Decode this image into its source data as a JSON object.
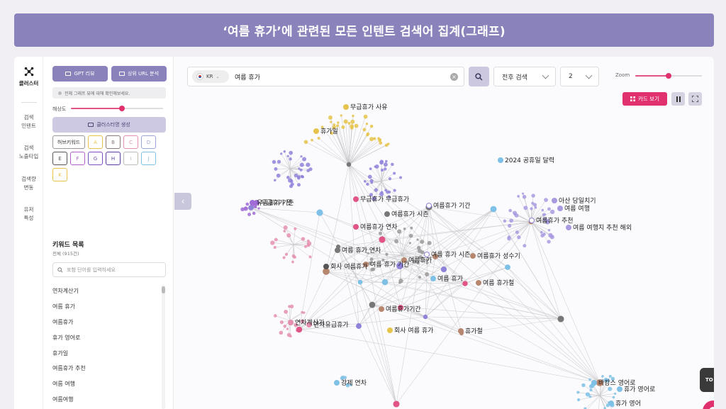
{
  "banner": {
    "title": "‘여름 휴가’에 관련된 모든 인텐트 검색어 집계(그래프)"
  },
  "nav": {
    "cluster_label": "클러스터",
    "items": [
      {
        "label": "검색\n인텐트"
      },
      {
        "label": "검색\n노출타입"
      },
      {
        "label": "검색량\n변동"
      },
      {
        "label": "유저\n특성"
      }
    ]
  },
  "panel": {
    "gpt_review": "GPT 리뷰",
    "top_url": "상위 URL 분석",
    "hint": "전체 그래프 뷰에 대해 확인해보세요.",
    "resolution_label": "해상도",
    "resolution_value": 0.55,
    "generate_cluster": "클러스터명 생성",
    "chips": [
      "허브키워드",
      "A",
      "B",
      "C",
      "D",
      "E",
      "F",
      "G",
      "H",
      "I",
      "J",
      "K"
    ],
    "chip_colors": {
      "허브키워드": "#555555",
      "A": "#e6c34a",
      "B": "#8a7a7a",
      "C": "#e58fb0",
      "D": "#9aa7d6",
      "E": "#555555",
      "F": "#b061c9",
      "G": "#7a4fc0",
      "H": "#5b3aa0",
      "I": "#bbbbbb",
      "J": "#7fc1e6",
      "K": "#e6c34a"
    },
    "keyword_title": "키워드 목록",
    "keyword_count": "전체 (915건)",
    "keyword_search_placeholder": "포함 단어를 입력하세요",
    "keywords": [
      "연차계산기",
      "여름 휴가",
      "여름휴가",
      "휴가 영어로",
      "휴가일",
      "여름휴가 추천",
      "여름 여행",
      "여름여행"
    ]
  },
  "toolbar": {
    "country": "KR",
    "query": "여름 휴가",
    "mode": "전후 검색",
    "depth": "2",
    "zoom_label": "Zoom",
    "zoom_value": 0.5,
    "card_view": "카드 보기",
    "top_button": "TO"
  },
  "graph": {
    "labels": [
      {
        "text": "무급휴가 사유",
        "color": "#e6c34a"
      },
      {
        "text": "휴가일",
        "color": "#e6c34a"
      },
      {
        "text": "2024 공휴일 달력",
        "color": "#7fc1e6"
      },
      {
        "text": "무급휴가 무급휴가",
        "color": "#e05585"
      },
      {
        "text": "여름휴가 기간",
        "color": "#ffffff"
      },
      {
        "text": "여름휴가 시즌",
        "color": "#777777"
      },
      {
        "text": "여름휴가 추천",
        "color": "#ffffff"
      },
      {
        "text": "아산 당일치기",
        "color": "#a99ae0"
      },
      {
        "text": "여름 여행",
        "color": "#a99ae0"
      },
      {
        "text": "여름 여행지 추천 해외",
        "color": "#a99ae0"
      },
      {
        "text": "여름휴가 연차",
        "color": "#e05585"
      },
      {
        "text": "여름 휴가 연차",
        "color": "#777777"
      },
      {
        "text": "여름 휴가 시즌",
        "color": "#ffffff"
      },
      {
        "text": "여름휴가 성수기",
        "color": "#b7866f"
      },
      {
        "text": "여름휴가",
        "color": "#b7866f"
      },
      {
        "text": "회사 여름휴가",
        "color": "#555555"
      },
      {
        "text": "여름 휴가 기간",
        "color": "#b7866f"
      },
      {
        "text": "여름 휴가",
        "color": "#7fc1e6"
      },
      {
        "text": "여름 휴가철",
        "color": "#b7866f"
      },
      {
        "text": "여름휴가기간",
        "color": "#b7866f"
      },
      {
        "text": "연차계산기",
        "color": "#e58fb0"
      },
      {
        "text": "연차유급휴가",
        "color": "#e58fb0"
      },
      {
        "text": "회사 여름 휴가",
        "color": "#e6c34a"
      },
      {
        "text": "휴가철",
        "color": "#b7866f"
      },
      {
        "text": "강제 연차",
        "color": "#7fc1e6"
      },
      {
        "text": "바캉스 영어로",
        "color": "#7fc1e6"
      },
      {
        "text": "휴가 영어로",
        "color": "#7fc1e6"
      },
      {
        "text": "휴가 영어",
        "color": "#7fc1e6"
      },
      {
        "text": "유급휴가 기준",
        "color": "#a06bd6"
      },
      {
        "text": "무급휴가 뜻",
        "color": "#a06bd6"
      }
    ]
  }
}
